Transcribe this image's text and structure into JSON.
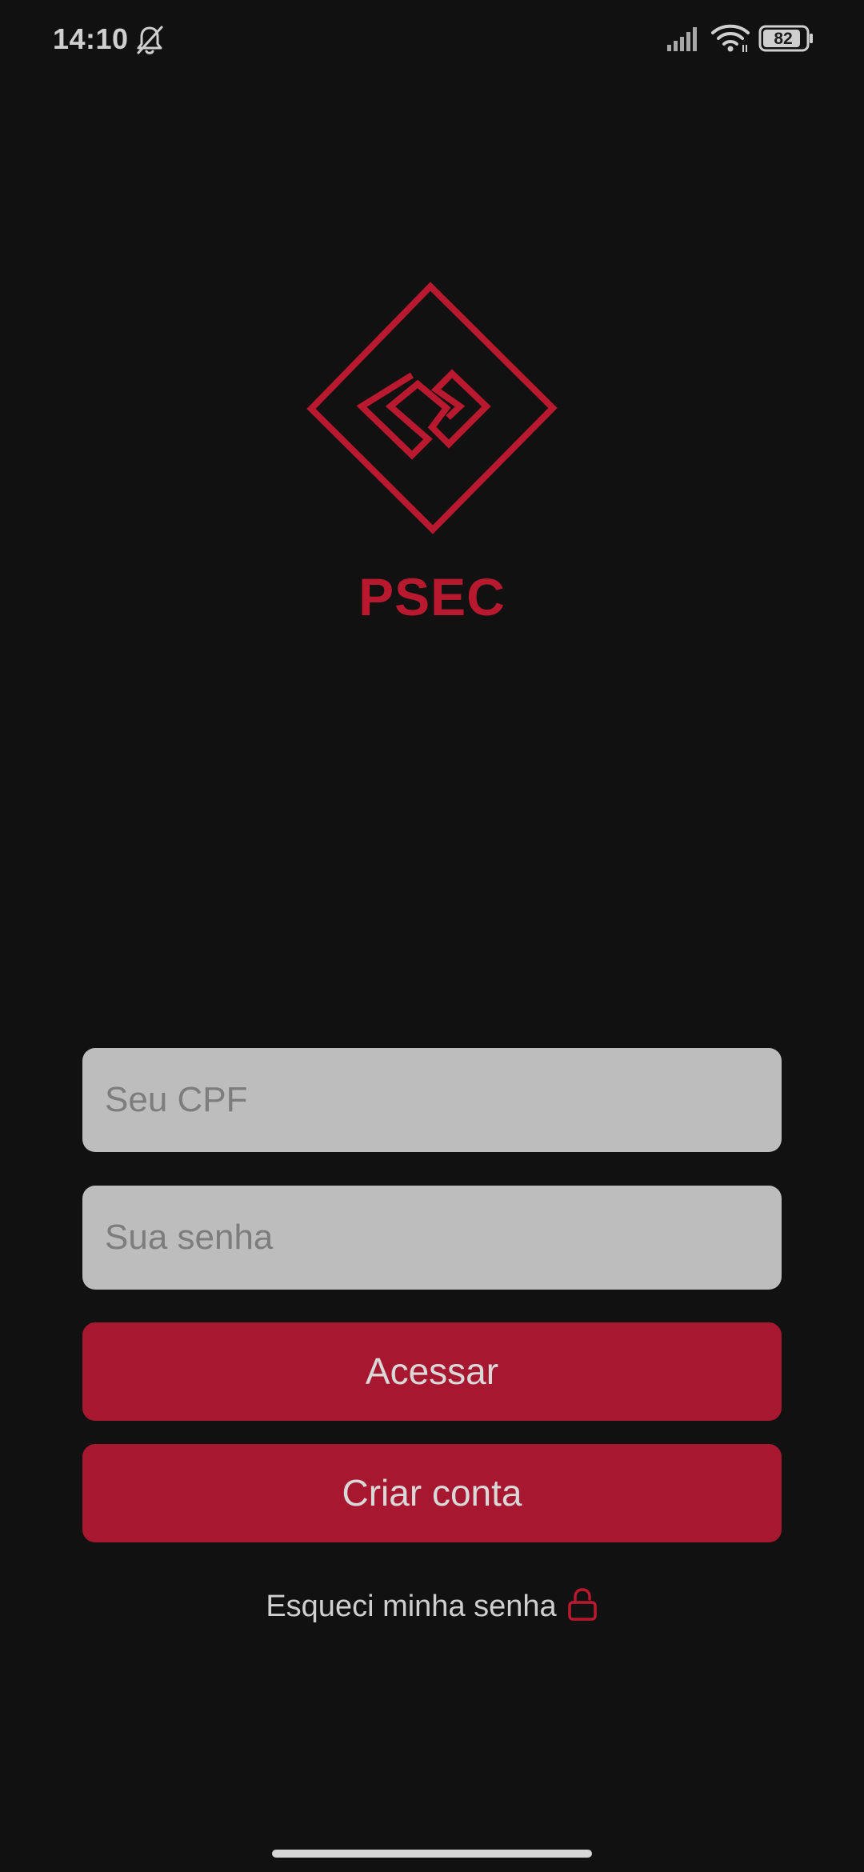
{
  "status_bar": {
    "time": "14:10",
    "battery_level": "82",
    "icons": [
      "bell-off-icon",
      "signal-icon",
      "wifi-icon",
      "battery-icon"
    ]
  },
  "brand": {
    "name": "PSEC",
    "logo_icon": "psec-diamond-logo",
    "color": "#b8192f"
  },
  "login_form": {
    "cpf_placeholder": "Seu CPF",
    "cpf_value": "",
    "password_placeholder": "Sua senha",
    "password_value": "",
    "access_button_label": "Acessar",
    "create_account_button_label": "Criar conta",
    "forgot_password_label": "Esqueci minha senha",
    "forgot_password_icon": "lock-icon"
  },
  "colors": {
    "background": "#111111",
    "accent": "#a71830",
    "field_background": "#bdbdbd",
    "text_light": "#cfcfcf"
  }
}
